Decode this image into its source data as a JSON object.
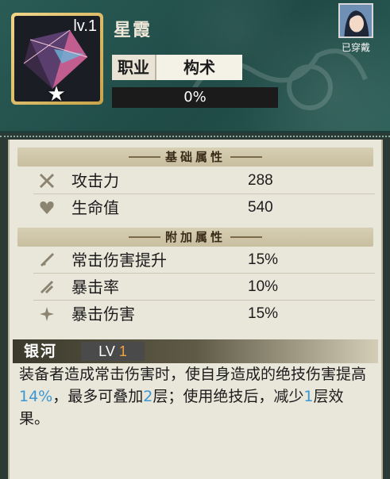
{
  "item": {
    "level": "lv.1",
    "name": "星霞",
    "class_label": "职业",
    "class_value": "构术",
    "progress": 0,
    "progress_text": "0%"
  },
  "character": {
    "status": "已穿戴"
  },
  "base_stats": {
    "title": "基础属性",
    "rows": [
      {
        "icon": "crossed-swords-icon",
        "name": "攻击力",
        "value": "288"
      },
      {
        "icon": "heart-icon",
        "name": "生命值",
        "value": "540"
      }
    ]
  },
  "extra_stats": {
    "title": "附加属性",
    "rows": [
      {
        "icon": "sword-icon",
        "name": "常击伤害提升",
        "value": "15%"
      },
      {
        "icon": "crit-rate-icon",
        "name": "暴击率",
        "value": "10%"
      },
      {
        "icon": "crit-damage-icon",
        "name": "暴击伤害",
        "value": "15%"
      }
    ]
  },
  "skill": {
    "name": "银河",
    "lv_label": "LV",
    "lv_value": "1",
    "desc_parts": [
      "装备者造成常击伤害时，使自身造成的绝技伤害提高",
      "14%",
      "，最多可叠加",
      "2",
      "层；使用绝技后，减少",
      "1",
      "层效果。"
    ]
  },
  "colors": {
    "header_bg": "#2a5b55",
    "panel_bg": "#e9e6da",
    "highlight": "#3a97d6",
    "level_accent": "#f0a23c"
  }
}
